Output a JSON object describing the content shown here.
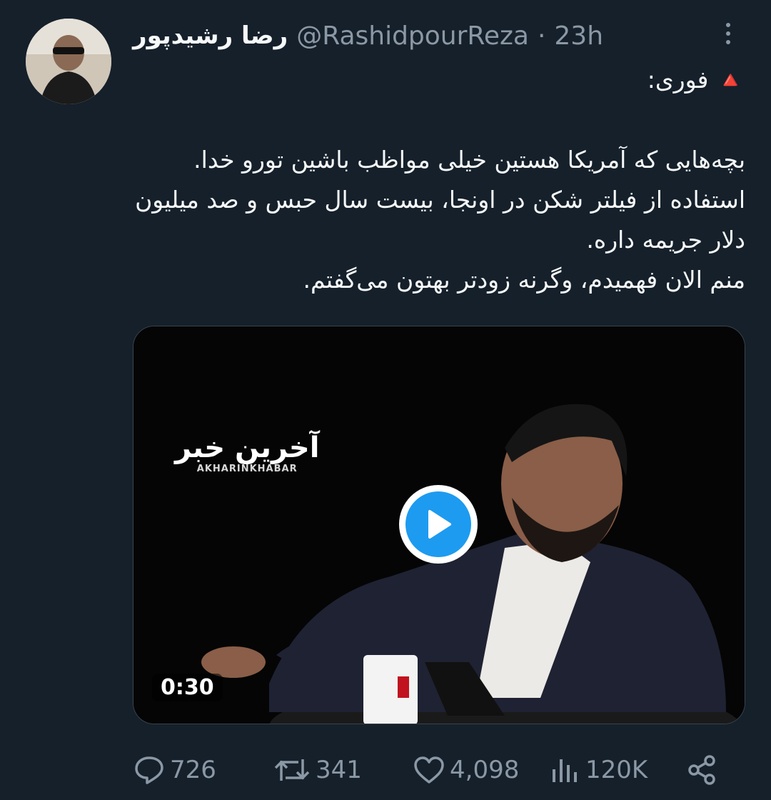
{
  "tweet": {
    "display_name": "رضا رشیدپور",
    "handle": "@RashidpourReza",
    "separator": "·",
    "timestamp": "23h",
    "text": "🔺 فوری:\n\nبچه‌هایی که آمریکا هستین خیلی مواظب باشین تورو خدا. استفاده از فیلتر شکن در اونجا، بیست سال حبس و صد میلیون دلار جریمه داره.\nمنم الان فهمیدم، وگرنه زودتر بهتون می‌گفتم."
  },
  "media": {
    "logo_text_fa": "آخرین خبر",
    "logo_text_en": "AKHARINKHABAR",
    "duration": "0:30"
  },
  "actions": {
    "replies": "726",
    "reposts": "341",
    "likes": "4,098",
    "views": "120K"
  },
  "icons": [
    "reply-icon",
    "repost-icon",
    "like-icon",
    "views-icon",
    "share-icon",
    "more-icon",
    "play-icon"
  ],
  "colors": {
    "background": "#15202b",
    "muted": "#8b98a5",
    "accent": "#1d9bf0"
  }
}
